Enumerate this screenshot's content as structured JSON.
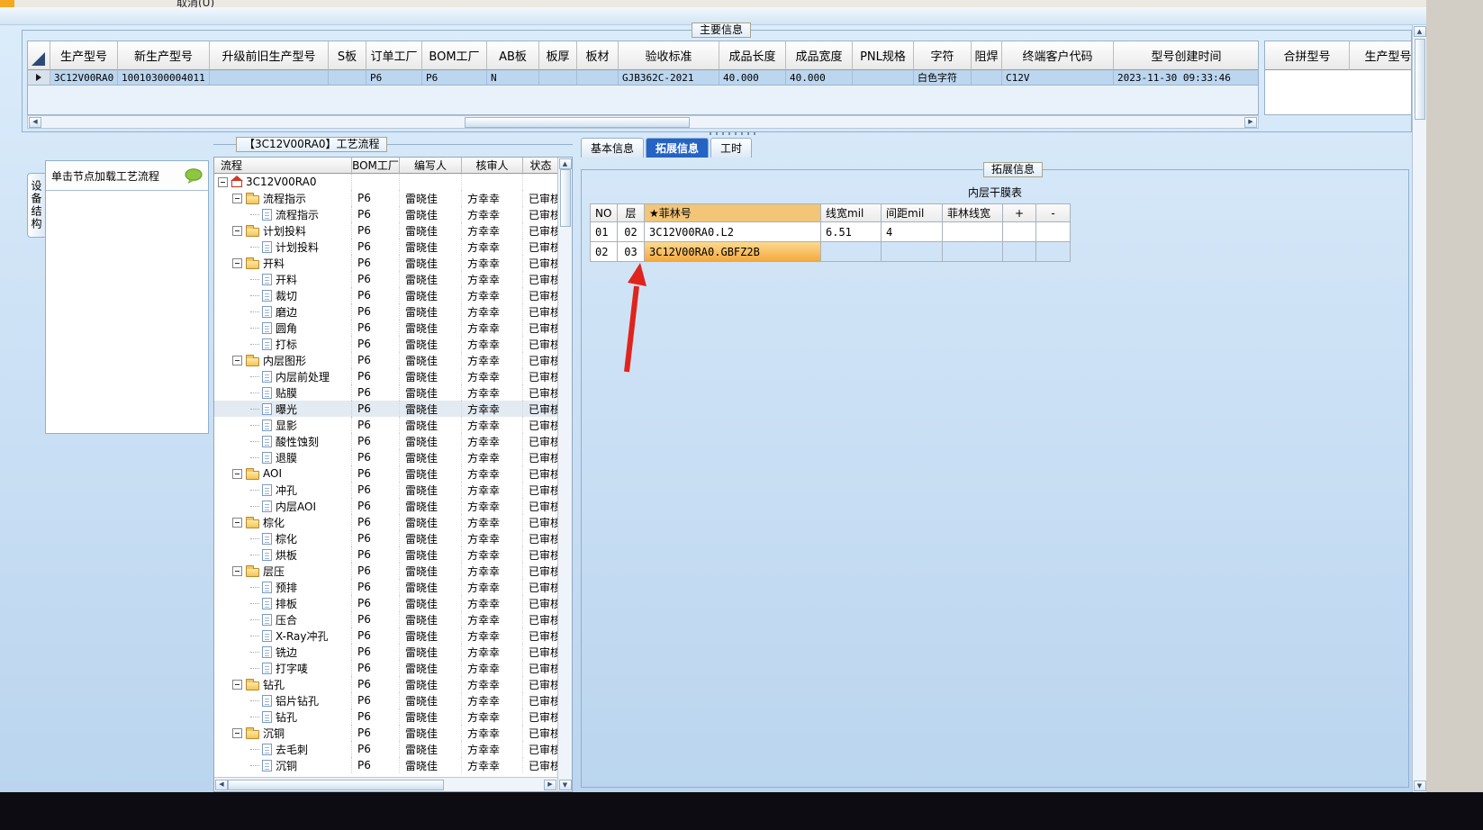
{
  "window": {
    "menu_partial": "取消(U)"
  },
  "colors": {
    "accent_orange": "#F6A821",
    "film_header_bg": "#F2C577",
    "film_highlight_top": "#FCD98F",
    "film_highlight_bottom": "#F5A93F",
    "active_tab_bg": "#2563C4",
    "selected_row_bg": "#BDD6EF",
    "arrow_red": "#E0241B"
  },
  "main_info": {
    "group_title": "主要信息",
    "columns": [
      "生产型号",
      "新生产型号",
      "升级前旧生产型号",
      "S板",
      "订单工厂",
      "BOM工厂",
      "AB板",
      "板厚",
      "板材",
      "验收标准",
      "成品长度",
      "成品宽度",
      "PNL规格",
      "字符",
      "阻焊",
      "终端客户代码",
      "型号创建时间"
    ],
    "row": [
      "3C12V00RA0",
      "10010300004011",
      "",
      "",
      "P6",
      "P6",
      "N",
      "",
      "",
      "GJB362C-2021",
      "40.000",
      "40.000",
      "",
      "白色字符",
      "",
      "C12V",
      "2023-11-30 09:33:46"
    ],
    "right_columns": [
      "合拼型号",
      "生产型号"
    ]
  },
  "left_panel": {
    "tab_label": "设备结构",
    "hint": "单击节点加载工艺流程"
  },
  "process_tree": {
    "title": "【3C12V00RA0】工艺流程",
    "columns": [
      "流程",
      "BOM工厂",
      "编写人",
      "核审人",
      "状态"
    ],
    "defaults": {
      "bom_factory": "P6",
      "writer": "雷晓佳",
      "reviewer": "方幸幸",
      "status": "已审核"
    },
    "root_label": "3C12V00RA0",
    "selected_node": "曝光",
    "groups": [
      {
        "folder": "流程指示",
        "children": [
          "流程指示"
        ]
      },
      {
        "folder": "计划投料",
        "children": [
          "计划投料"
        ]
      },
      {
        "folder": "开料",
        "children": [
          "开料",
          "裁切",
          "磨边",
          "圆角",
          "打标"
        ]
      },
      {
        "folder": "内层图形",
        "children": [
          "内层前处理",
          "贴膜",
          "曝光",
          "显影",
          "酸性蚀刻",
          "退膜"
        ]
      },
      {
        "folder": "AOI",
        "children": [
          "冲孔",
          "内层AOI"
        ]
      },
      {
        "folder": "棕化",
        "children": [
          "棕化",
          "烘板"
        ]
      },
      {
        "folder": "层压",
        "children": [
          "预排",
          "排板",
          "压合",
          "X-Ray冲孔",
          "铣边",
          "打字唛"
        ]
      },
      {
        "folder": "钻孔",
        "children": [
          "铝片钻孔",
          "钻孔"
        ]
      },
      {
        "folder": "沉铜",
        "children": [
          "去毛刺",
          "沉铜"
        ]
      }
    ]
  },
  "detail_panel": {
    "tabs": [
      "基本信息",
      "拓展信息",
      "工时"
    ],
    "active_tab": "拓展信息",
    "group_title": "拓展信息",
    "table_title": "内层干膜表",
    "table": {
      "columns": [
        "NO",
        "层",
        "★菲林号",
        "线宽mil",
        "间距mil",
        "菲林线宽",
        "+",
        "-"
      ],
      "rows": [
        [
          "01",
          "02",
          "3C12V00RA0.L2",
          "6.51",
          "4",
          "",
          "",
          ""
        ],
        [
          "02",
          "03",
          "3C12V00RA0.GBFZ2B",
          "",
          "",
          "",
          "",
          ""
        ]
      ],
      "highlight": {
        "row": 1,
        "col": 2
      }
    }
  }
}
